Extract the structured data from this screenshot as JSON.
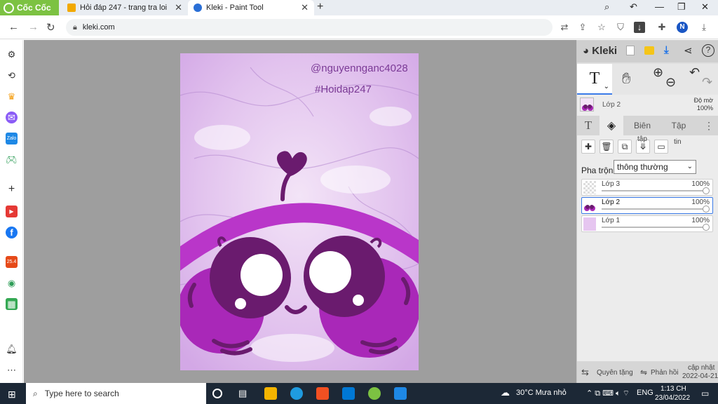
{
  "browser": {
    "brand": "Cốc Cốc",
    "tabs": [
      {
        "title": "Hỏi đáp 247 - trang tra loi",
        "favicon": "hoidap-favicon"
      },
      {
        "title": "Kleki - Paint Tool",
        "favicon": "kleki-favicon",
        "active": true
      }
    ],
    "url": "kleki.com",
    "profile_initial": "N"
  },
  "kleki": {
    "title": "Kleki",
    "current_layer": {
      "name": "Lớp 2",
      "opacity_label": "Độ mờ",
      "opacity": "100%"
    },
    "tabs": [
      "Biên",
      "Tập"
    ],
    "button_tooltips": [
      "tập",
      "tin"
    ],
    "blend_label": "Pha trộn",
    "blend_mode": "thông thường",
    "layers": [
      {
        "name": "Lớp 3",
        "opacity": "100%"
      },
      {
        "name": "Lớp 2",
        "opacity": "100%",
        "selected": true
      },
      {
        "name": "Lớp 1",
        "opacity": "100%"
      }
    ],
    "footer": {
      "rights": "Quyên tặng",
      "feedback": "Phản hồi",
      "update_label": "cập nhật",
      "update_date": "2022-04-21"
    }
  },
  "artwork": {
    "credit1": "@nguyennganc4028",
    "credit2": "#Hoidap247",
    "colors": {
      "purple_dark": "#6a1b6e",
      "magenta": "#a928b8",
      "arc": "#b936c9"
    }
  },
  "taskbar": {
    "search_placeholder": "Type here to search",
    "weather": "30°C Mưa nhỏ",
    "lang": "ENG",
    "time": "1:13 CH",
    "date": "23/04/2022"
  }
}
